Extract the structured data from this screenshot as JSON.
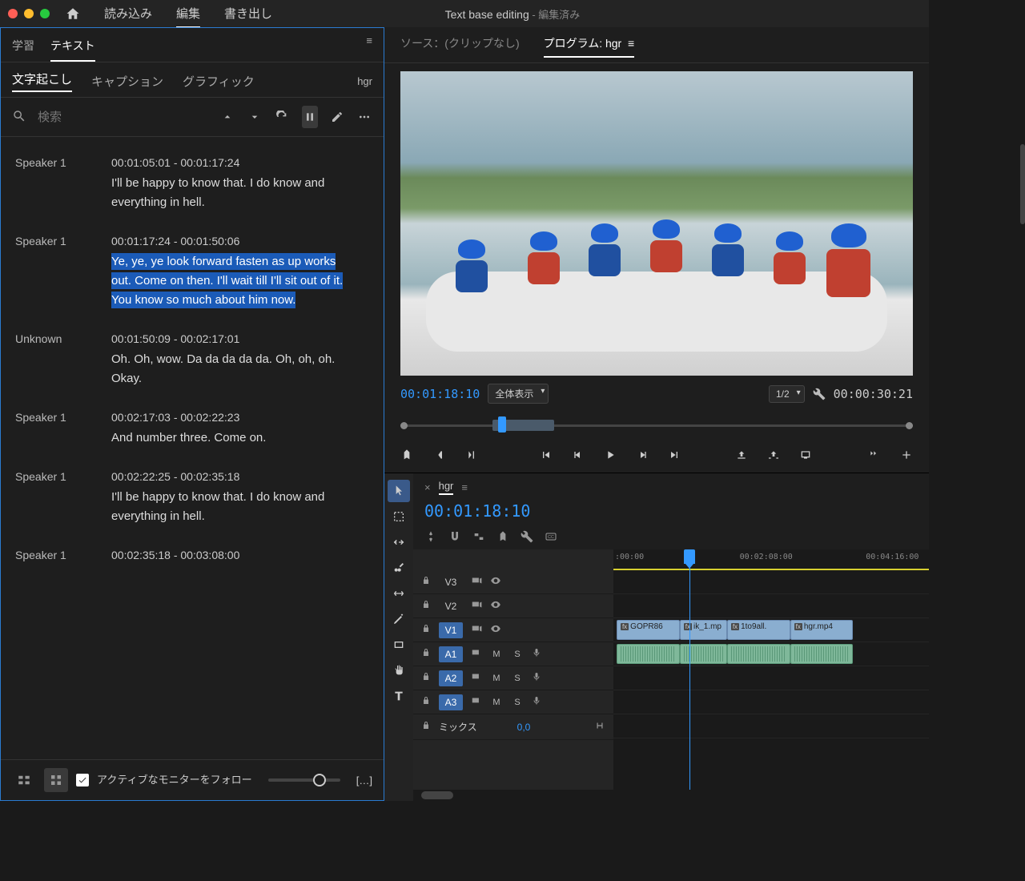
{
  "title": {
    "main": "Text base editing",
    "edited": " - 編集済み"
  },
  "topTabs": {
    "import": "読み込み",
    "edit": "編集",
    "export": "書き出し"
  },
  "leftPanel": {
    "tabs": {
      "learn": "学習",
      "text": "テキスト"
    },
    "subTabs": {
      "transcribe": "文字起こし",
      "caption": "キャプション",
      "graphic": "グラフィック"
    },
    "sequence": "hgr",
    "searchPlaceholder": "検索",
    "entries": [
      {
        "speaker": "Speaker 1",
        "time": "00:01:05:01 - 00:01:17:24",
        "text": "I'll be happy to know that. I do know and everything in hell.",
        "sel": false
      },
      {
        "speaker": "Speaker 1",
        "time": "00:01:17:24 - 00:01:50:06",
        "text": "Ye, ye, ye look forward fasten as up works out. Come on then. I'll wait till I'll sit out of it. You know so much about him now.",
        "sel": true
      },
      {
        "speaker": "Unknown",
        "time": "00:01:50:09 - 00:02:17:01",
        "text": "Oh. Oh, wow. Da da da da da. Oh, oh, oh. Okay.",
        "sel": false
      },
      {
        "speaker": "Speaker 1",
        "time": "00:02:17:03 - 00:02:22:23",
        "text": "And number three. Come on.",
        "sel": false
      },
      {
        "speaker": "Speaker 1",
        "time": "00:02:22:25 - 00:02:35:18",
        "text": "I'll be happy to know that. I do know and everything in hell.",
        "sel": false
      },
      {
        "speaker": "Speaker 1",
        "time": "00:02:35:18 - 00:03:08:00",
        "text": "",
        "sel": false
      }
    ],
    "footer": {
      "follow": "アクティブなモニターをフォロー",
      "more": "[…]"
    }
  },
  "monitor": {
    "sourceTab": "ソース：(クリップなし)",
    "programTab": "プログラム: hgr",
    "tcIn": "00:01:18:10",
    "tcOut": "00:00:30:21",
    "fit": "全体表示",
    "res": "1/2"
  },
  "timeline": {
    "name": "hgr",
    "tc": "00:01:18:10",
    "ruler": [
      ":00:00",
      "00:02:08:00",
      "00:04:16:00"
    ],
    "tracks": {
      "v3": "V3",
      "v2": "V2",
      "v1": "V1",
      "a1": "A1",
      "a2": "A2",
      "a3": "A3",
      "mix": "ミックス",
      "mixVal": "0,0",
      "m": "M",
      "s": "S"
    },
    "clips": {
      "c1": "GOPR86",
      "c2": "ik_1.mp",
      "c3": "1to9all.",
      "c4": "hgr.mp4"
    }
  }
}
